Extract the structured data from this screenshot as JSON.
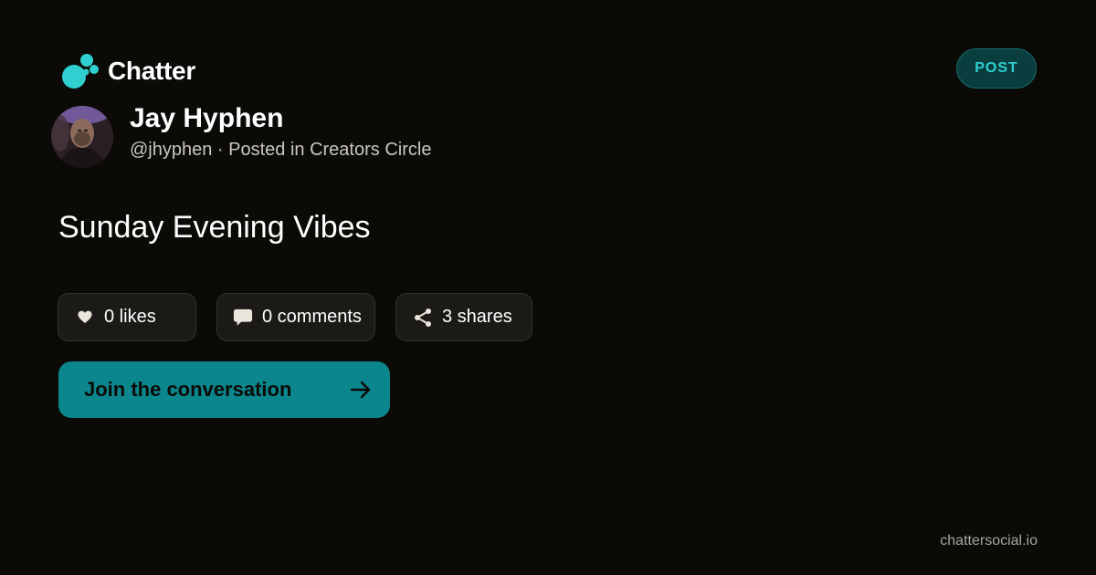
{
  "brand": {
    "name": "Chatter",
    "logo_icon": "bubbles-logo-icon",
    "accent_color": "#2fd0cf"
  },
  "badge": {
    "label": "POST"
  },
  "author": {
    "name": "Jay Hyphen",
    "meta": "@jhyphen · Posted in Creators Circle",
    "avatar_icon": "user-avatar"
  },
  "post": {
    "title": "Sunday Evening Vibes"
  },
  "stats": {
    "likes": {
      "label": "0 likes",
      "icon": "heart-icon"
    },
    "comments": {
      "label": "0 comments",
      "icon": "speech-bubble-icon"
    },
    "shares": {
      "label": "3 shares",
      "icon": "share-icon"
    }
  },
  "cta": {
    "label": "Join the conversation",
    "icon": "arrow-right-icon",
    "color": "#0b868d"
  },
  "footer": {
    "domain": "chattersocial.io"
  }
}
